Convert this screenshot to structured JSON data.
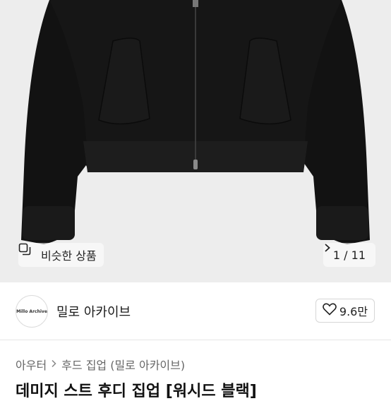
{
  "image_nav": {
    "similar_label": "비슷한 상품",
    "similar_icon": "similar-items-icon",
    "counter": "1 / 11",
    "next_icon": "chevron-right-icon"
  },
  "seller": {
    "avatar_text": "Millo Archive",
    "name": "밀로 아카이브",
    "like_count": "9.6만",
    "like_icon": "heart-outline-icon"
  },
  "breadcrumb": {
    "items": [
      "아우터",
      "후드 집업 (밀로 아카이브)"
    ]
  },
  "product": {
    "title": "데미지 스트 후디 집업 [워시드 블랙]"
  },
  "colors": {
    "hero_bg": "#ededed",
    "garment": "#141414"
  }
}
